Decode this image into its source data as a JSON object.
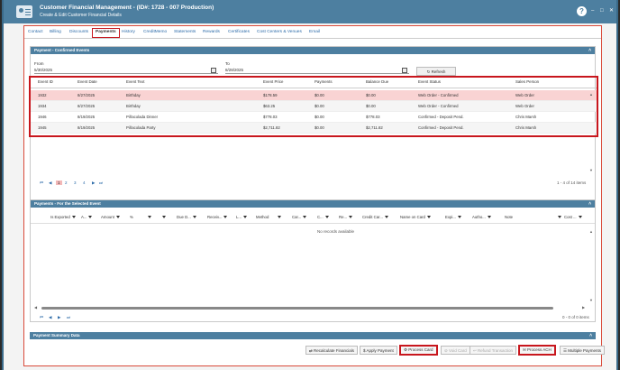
{
  "window": {
    "title": "Customer Financial Management - (ID#: 1728 - 007 Production)",
    "subtitle": "Create & Edit Customer Financial Details",
    "help": "?",
    "minimize": "–",
    "restore": "□",
    "close": "✕"
  },
  "tabs": [
    "Contact",
    "Billing",
    "Discounts",
    "Payments",
    "History",
    "CreditMemo",
    "Statements",
    "Rewards",
    "Certificates",
    "Cost Centers & Venues",
    "Email"
  ],
  "confirmed": {
    "header": "Payment - Confirmed Events",
    "collapse": "˄",
    "from_label": "From",
    "from_value": "5/30/2025",
    "to_label": "To",
    "to_value": "8/28/2025",
    "refresh": "↻ Refresh",
    "columns": [
      "Event ID",
      "Event Date",
      "Event Text",
      "Event Price",
      "Payments",
      "Balance Due",
      "Event Status",
      "Sales Person"
    ],
    "rows": [
      [
        "1932",
        "8/27/2025",
        "Birthday",
        "$178.59",
        "$0.00",
        "$0.00",
        "Web Order - Confirmed",
        "Web Order"
      ],
      [
        "1934",
        "8/27/2025",
        "Birthday",
        "$63.25",
        "$0.00",
        "$0.00",
        "Web Order - Confirmed",
        "Web Order"
      ],
      [
        "1946",
        "8/19/2025",
        "Piñacolada Dinner",
        "$778.03",
        "$0.00",
        "$778.03",
        "Confirmed - Deposit Pend.",
        "Chris Marsh"
      ],
      [
        "1945",
        "8/19/2025",
        "Piñacolada Party",
        "$2,711.82",
        "$0.00",
        "$2,711.82",
        "Confirmed - Deposit Pend.",
        "Chris Marsh"
      ]
    ],
    "pager": {
      "first": "⏮",
      "prev": "◀",
      "pages": [
        "1",
        "2",
        "3",
        "4"
      ],
      "next": "▶",
      "last": "⏭",
      "info": "1 - 4 of 14 items"
    }
  },
  "payments": {
    "header": "Payments - For the Selected Event",
    "collapse": "˄",
    "columns": [
      "Is Exported",
      "A...",
      "Amount",
      "%",
      "",
      "Due D...",
      "Receiv...",
      "L...",
      "Method",
      "Car...",
      "C...",
      "Re...",
      "Credit Car...",
      "Name on Card",
      "Expi...",
      "Autho...",
      "Note",
      "Cost ..."
    ],
    "no_records": "No records available",
    "pager": {
      "first": "⏮",
      "prev": "◀",
      "next": "▶",
      "last": "⏭",
      "info": "0 - 0 of 0 items"
    }
  },
  "summary": {
    "header": "Payment Summary Data",
    "collapse": "˄"
  },
  "buttons": {
    "recalc": "⇄ Recalculate Financials",
    "apply": "$ Apply Payment",
    "process_card": "⚙ Process Card",
    "void_card": "⊘ Void Card",
    "refund": "↩ Refund Transaction",
    "process_ach": "✉ Process ACH",
    "multiple": "☰ Multiple Payments"
  }
}
